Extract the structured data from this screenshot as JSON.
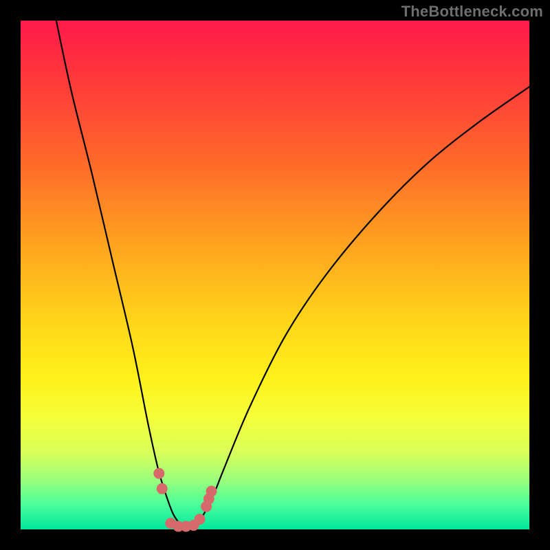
{
  "watermark": "TheBottleneck.com",
  "chart_data": {
    "type": "line",
    "title": "",
    "xlabel": "",
    "ylabel": "",
    "xlim": [
      0,
      100
    ],
    "ylim": [
      0,
      100
    ],
    "series": [
      {
        "name": "bottleneck-curve",
        "x": [
          7,
          10,
          14,
          18,
          22,
          25,
          27,
          28.5,
          30,
          31.5,
          33,
          34.5,
          36,
          38,
          40,
          45,
          52,
          60,
          70,
          80,
          90,
          100
        ],
        "y": [
          100,
          86,
          70,
          53,
          36,
          21,
          12,
          7,
          3,
          1,
          0.5,
          1,
          3,
          7,
          12,
          24,
          38,
          50,
          62,
          72,
          80,
          87
        ]
      }
    ],
    "markers": {
      "name": "highlight-dots",
      "color": "#d66a6a",
      "points": [
        {
          "x": 27.2,
          "y": 11
        },
        {
          "x": 27.8,
          "y": 8
        },
        {
          "x": 29.5,
          "y": 1.2
        },
        {
          "x": 31.0,
          "y": 0.6
        },
        {
          "x": 32.5,
          "y": 0.6
        },
        {
          "x": 34.0,
          "y": 0.8
        },
        {
          "x": 35.2,
          "y": 2.0
        },
        {
          "x": 36.5,
          "y": 4.5
        },
        {
          "x": 37.0,
          "y": 6.0
        },
        {
          "x": 37.5,
          "y": 7.5
        }
      ]
    },
    "gradient_stops": [
      {
        "pos": 0,
        "color": "#ff1a4b"
      },
      {
        "pos": 12,
        "color": "#ff3a3a"
      },
      {
        "pos": 28,
        "color": "#ff6a2a"
      },
      {
        "pos": 44,
        "color": "#ffa31f"
      },
      {
        "pos": 58,
        "color": "#ffd21a"
      },
      {
        "pos": 70,
        "color": "#fff01a"
      },
      {
        "pos": 78,
        "color": "#f5ff3a"
      },
      {
        "pos": 85,
        "color": "#d8ff5a"
      },
      {
        "pos": 90,
        "color": "#9eff7a"
      },
      {
        "pos": 95,
        "color": "#4dff9a"
      },
      {
        "pos": 100,
        "color": "#00e79e"
      }
    ]
  }
}
